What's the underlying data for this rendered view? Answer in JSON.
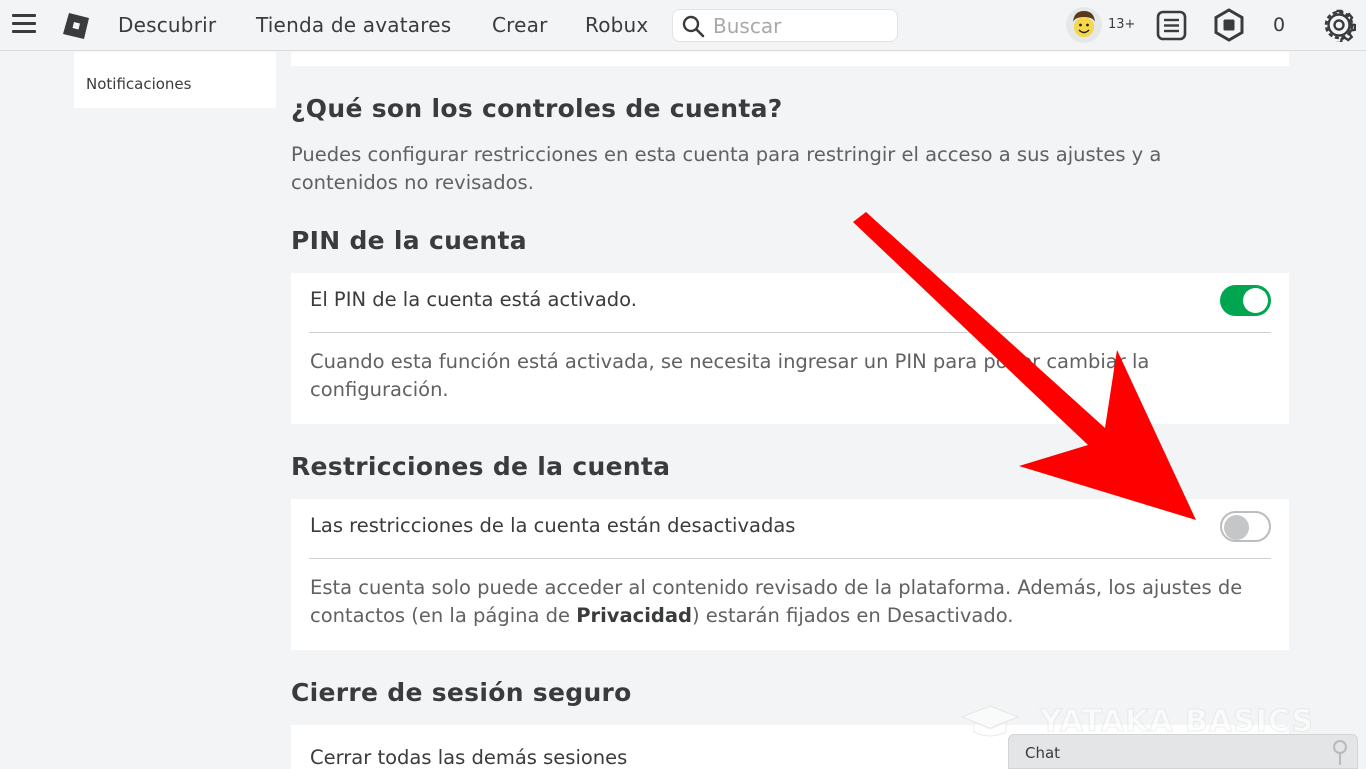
{
  "nav": {
    "discover": "Descubrir",
    "avatar_shop": "Tienda de avatares",
    "create": "Crear",
    "robux": "Robux",
    "search_placeholder": "Buscar",
    "age_badge": "13+",
    "robux_balance": "0"
  },
  "sidebar": {
    "items": [
      {
        "label": "Notificaciones"
      }
    ]
  },
  "sections": {
    "controls": {
      "title": "¿Qué son los controles de cuenta?",
      "description": "Puedes configurar restricciones en esta cuenta para restringir el acceso a sus ajustes y a contenidos no revisados."
    },
    "pin": {
      "title": "PIN de la cuenta",
      "status": "El PIN de la cuenta está activado.",
      "toggle_on": true,
      "description": "Cuando esta función está activada, se necesita ingresar un PIN para poder cambiar la configuración."
    },
    "restrictions": {
      "title": "Restricciones de la cuenta",
      "status": "Las restricciones de la cuenta están desactivadas",
      "toggle_on": false,
      "description_before": "Esta cuenta solo puede acceder al contenido revisado de la plataforma. Además, los ajustes de contactos (en la página de ",
      "description_link": "Privacidad",
      "description_after": ") estarán fijados en Desactivado."
    },
    "logout": {
      "title": "Cierre de sesión seguro",
      "row": "Cerrar todas las demás sesiones"
    }
  },
  "watermark": "YATAKA BASICS",
  "chat": {
    "label": "Chat"
  },
  "colors": {
    "background": "#f2f4f5",
    "card": "#ffffff",
    "toggle_on": "#00a64f",
    "annotation_arrow": "#ff0000",
    "text": "#393b3d",
    "muted_text": "#606162"
  },
  "icons": [
    "menu-icon",
    "roblox-logo",
    "search-icon",
    "notes-icon",
    "robux-icon",
    "gear-icon",
    "chat-icon",
    "graduation-cap-icon"
  ]
}
